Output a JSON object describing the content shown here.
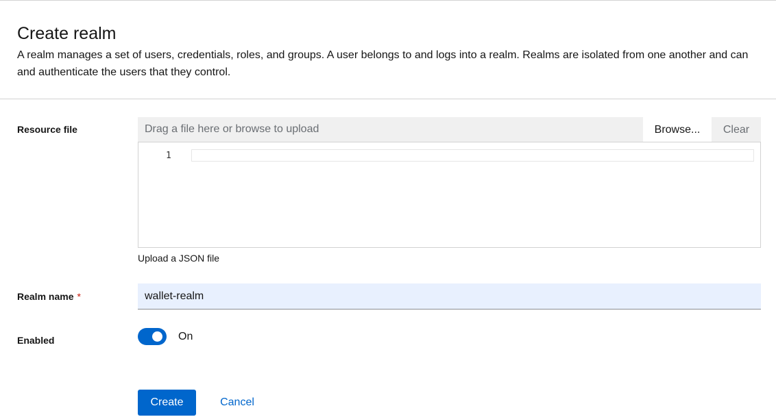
{
  "header": {
    "title": "Create realm",
    "description_line1": "A realm manages a set of users, credentials, roles, and groups. A user belongs to and logs into a realm. Realms are isolated from one another and can",
    "description_line2": "and authenticate the users that they control."
  },
  "form": {
    "resource_file": {
      "label": "Resource file",
      "placeholder": "Drag a file here or browse to upload",
      "browse_label": "Browse...",
      "clear_label": "Clear",
      "editor_line_number": "1",
      "helper_text": "Upload a JSON file"
    },
    "realm_name": {
      "label": "Realm name",
      "required_marker": "*",
      "value": "wallet-realm"
    },
    "enabled": {
      "label": "Enabled",
      "state_label": "On",
      "checked": true
    }
  },
  "actions": {
    "create_label": "Create",
    "cancel_label": "Cancel"
  },
  "colors": {
    "primary": "#0066cc",
    "required": "#c9190b",
    "input_bg": "#e8f0fe"
  }
}
